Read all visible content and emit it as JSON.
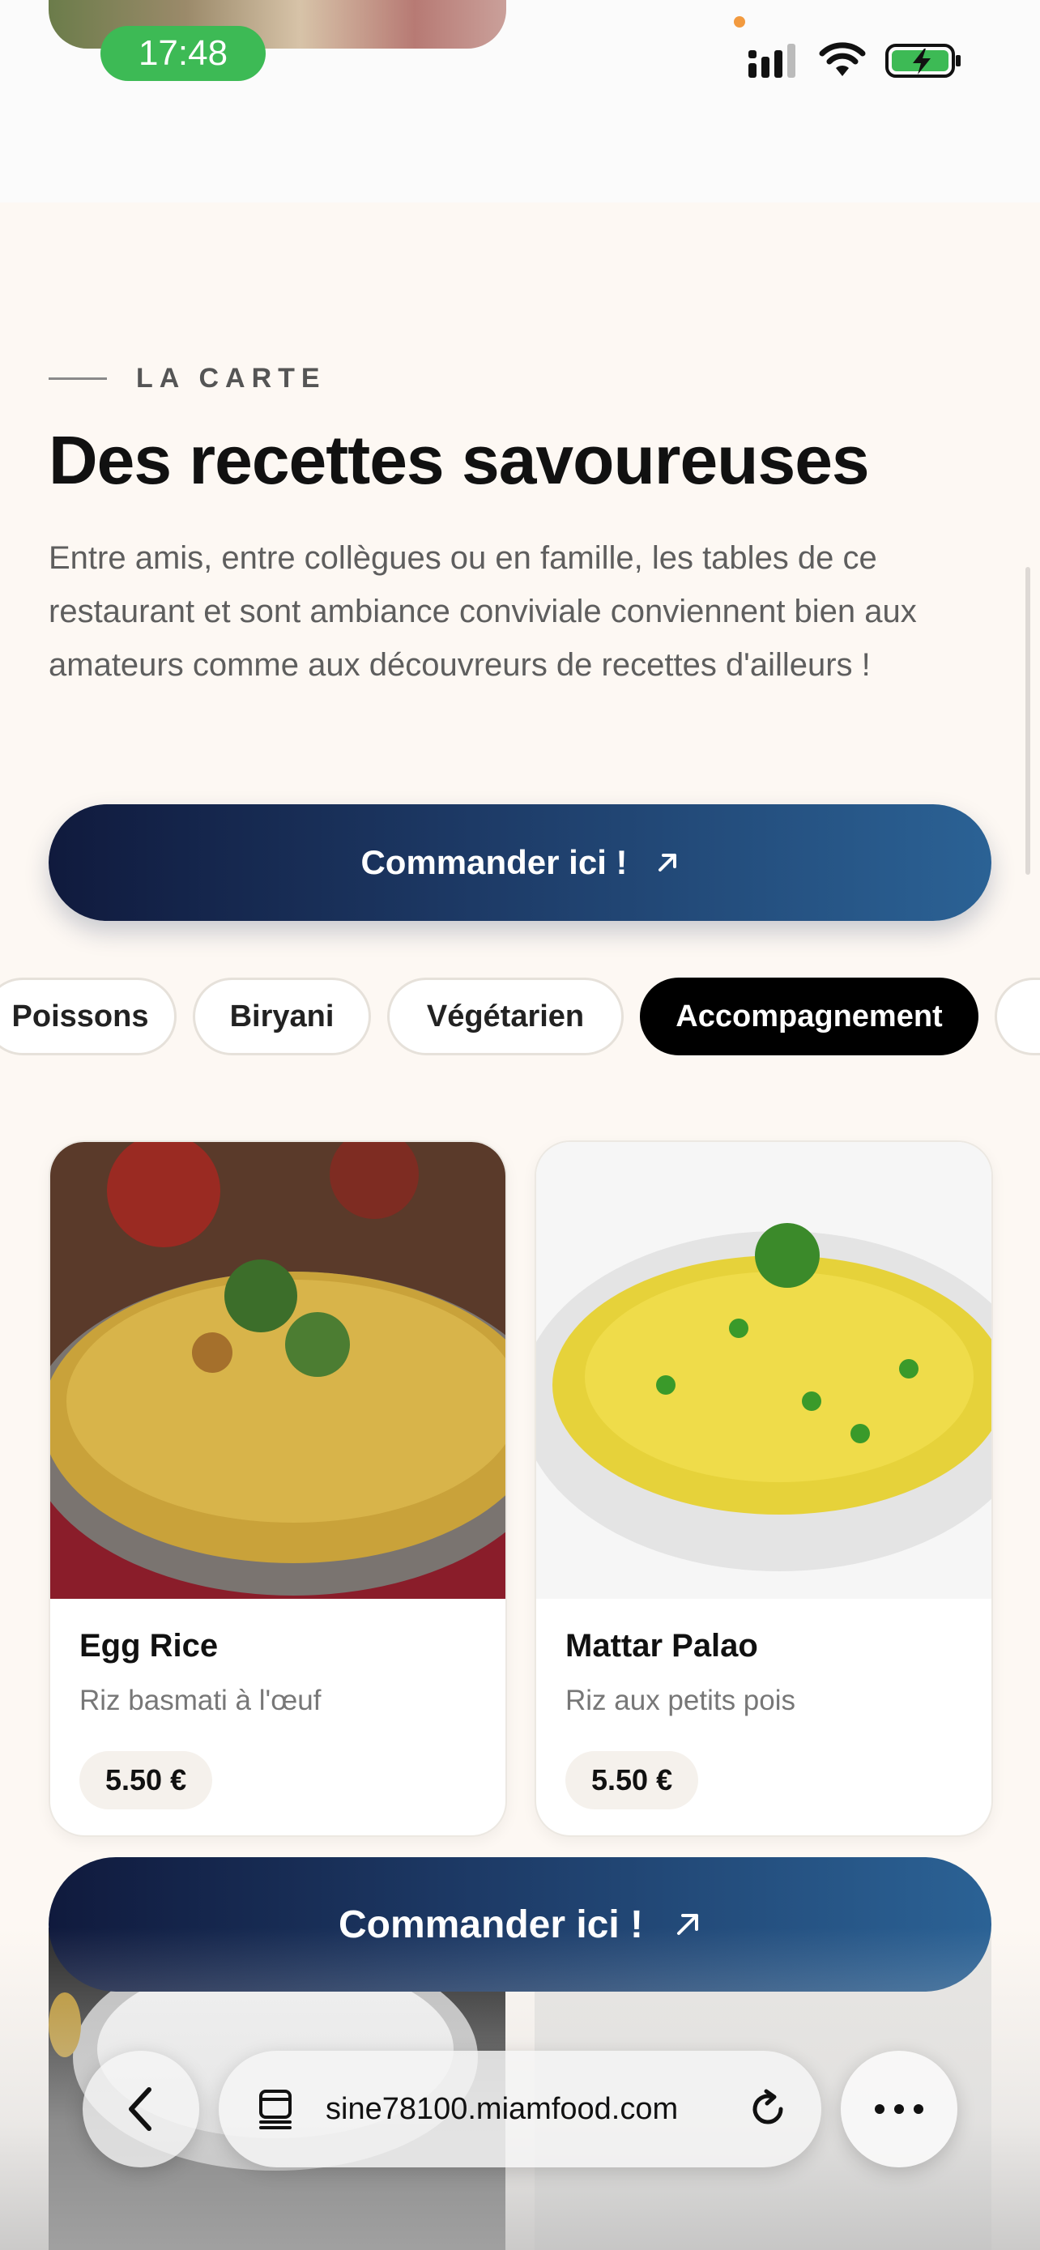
{
  "status_bar": {
    "time": "17:48"
  },
  "section": {
    "eyebrow": "LA CARTE",
    "title": "Des recettes savoureuses",
    "description": "Entre amis, entre collègues ou en famille, les tables de ce restaurant et sont ambiance conviviale conviennent bien aux amateurs comme aux découvreurs de recettes d'ailleurs !",
    "cta_label": "Commander ici !"
  },
  "categories": [
    "Poissons",
    "Biryani",
    "Végétarien",
    "Accompagnement"
  ],
  "active_category": "Accompagnement",
  "dishes": [
    {
      "name": "Egg Rice",
      "description": "Riz basmati à l'œuf",
      "price": "5.50 €"
    },
    {
      "name": "Mattar Palao",
      "description": "Riz aux petits pois",
      "price": "5.50 €"
    }
  ],
  "floating_cta": {
    "label": "Commander ici !"
  },
  "browser": {
    "url": "sine78100.miamfood.com"
  },
  "colors": {
    "accent_start": "#101a3d",
    "accent_end": "#2b6295",
    "time_pill": "#3dba55"
  }
}
